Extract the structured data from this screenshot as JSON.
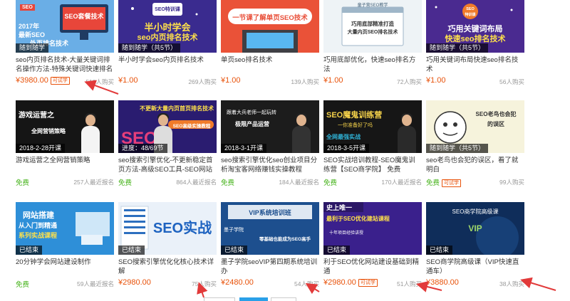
{
  "colors": {
    "price": "#e8520a",
    "free": "#46b31b",
    "annotation_arrow": "#e23a3a"
  },
  "courses": [
    {
      "tag": "随到随学",
      "title": "seo内页排名技术-大量关键词排名操作方法-特殊关键词快速排名",
      "price": "¥3980.00",
      "badge": "可试学",
      "count": "518人购买",
      "thumb": {
        "lines": [
          "SEO套餐技术",
          "2017年",
          "最新SEO",
          "外页排名技术"
        ]
      }
    },
    {
      "tag": "随到随学（共5节）",
      "title": "半小时学会seo内页排名技术",
      "price": "¥1.00",
      "badge": "",
      "count": "269人购买",
      "thumb": {
        "lines": [
          "半小时学会",
          "seo内页排名技术"
        ]
      }
    },
    {
      "tag": "",
      "title": "单页seo排名技术",
      "price": "¥1.00",
      "badge": "",
      "count": "139人购买",
      "thumb": {
        "lines": [
          "一节课了解单页SEO技术"
        ]
      }
    },
    {
      "tag": "",
      "title": "巧用底部优化，快速seo排名方法",
      "price": "¥1.00",
      "badge": "",
      "count": "72人购买",
      "thumb": {
        "lines": [
          "童子营SEO教学",
          "巧用底部精准打造",
          "大量内页SEO排名技术"
        ]
      }
    },
    {
      "tag": "随到随学（共5节）",
      "title": "巧用关键词布局快速seo排名技术",
      "price": "¥1.00",
      "badge": "",
      "count": "56人购买",
      "thumb": {
        "lines": [
          "SEO",
          "特训课",
          "巧用关键词布局",
          "快速seo排名技术"
        ]
      }
    },
    {
      "tag": "2018-2-28开课",
      "title": "游戏运营之全网营销策略",
      "price": "免费",
      "badge": "",
      "count": "257人最近报名",
      "thumb": {
        "lines": [
          "游戏运营之",
          "全网营销策略"
        ]
      }
    },
    {
      "tag": "进度：48/69节",
      "title": "seo搜索引擎优化-不更新稳定首页方法-高级SEO工具-SEO网站优化",
      "price": "免费",
      "badge": "",
      "count": "864人最近报名",
      "thumb": {
        "lines": [
          "不更新大量内页首页排名技术",
          "SEO高级实操教程",
          "SEO"
        ]
      }
    },
    {
      "tag": "2018-3-1开课",
      "title": "seo搜索引擎优化seo创业项目分析淘宝客网络赚钱实操教程",
      "price": "免费",
      "badge": "",
      "count": "184人最近报名",
      "thumb": {
        "lines": [
          "跟着大兵老师一起玩转",
          "极限产品运营"
        ]
      }
    },
    {
      "tag": "2018-3-5开课",
      "title": "SEO实战培训教程-SEO魔鬼训练营【SEO商学院】 免费",
      "price": "免费",
      "badge": "",
      "count": "170人最近报名",
      "thumb": {
        "lines": [
          "SEO魔鬼训练营",
          "一你准备好了吗",
          "全网最强实战"
        ]
      }
    },
    {
      "tag": "随到随学（共5节）",
      "title": "seo老鸟也会犯的误区，看了就明白",
      "price": "免费",
      "badge": "可试学",
      "count": "99人购买",
      "thumb": {
        "lines": [
          "SEO老鸟也会犯",
          "的误区"
        ]
      }
    },
    {
      "tag": "已结束",
      "title": "20分钟学会网站建设制作",
      "price": "免费",
      "badge": "",
      "count": "59人最近报名",
      "thumb": {
        "lines": [
          "网站搭建",
          "从入门到精通",
          "系列实战课程"
        ]
      }
    },
    {
      "tag": "已结束",
      "title": "SEO搜索引擎优化化核心技术详解",
      "price": "¥2980.00",
      "badge": "",
      "count": "75人购买",
      "thumb": {
        "lines": [
          "SEO实战"
        ]
      }
    },
    {
      "tag": "已结束",
      "title": "墨子学院seoVIP第四期系统培训办",
      "price": "¥2480.00",
      "badge": "",
      "count": "54人购买",
      "thumb": {
        "lines": [
          "VIP系统培训班",
          "墨子学院",
          "零基础也能成为SEO高手"
        ]
      }
    },
    {
      "tag": "已结束",
      "title": "利于SEO优化网站建设基础到精通",
      "price": "¥2980.00",
      "badge": "可试学",
      "count": "51人购买",
      "thumb": {
        "lines": [
          "史上唯一",
          "最利于SEO优化建站课程",
          "十年项目经验讲授"
        ]
      }
    },
    {
      "tag": "已结束",
      "title": "SEO商学院高级课（VIP快速直通车）",
      "price": "¥3880.00",
      "badge": "",
      "count": "38人购买",
      "thumb": {
        "lines": [
          "SEO商学院高级课",
          "VIP"
        ]
      }
    }
  ]
}
